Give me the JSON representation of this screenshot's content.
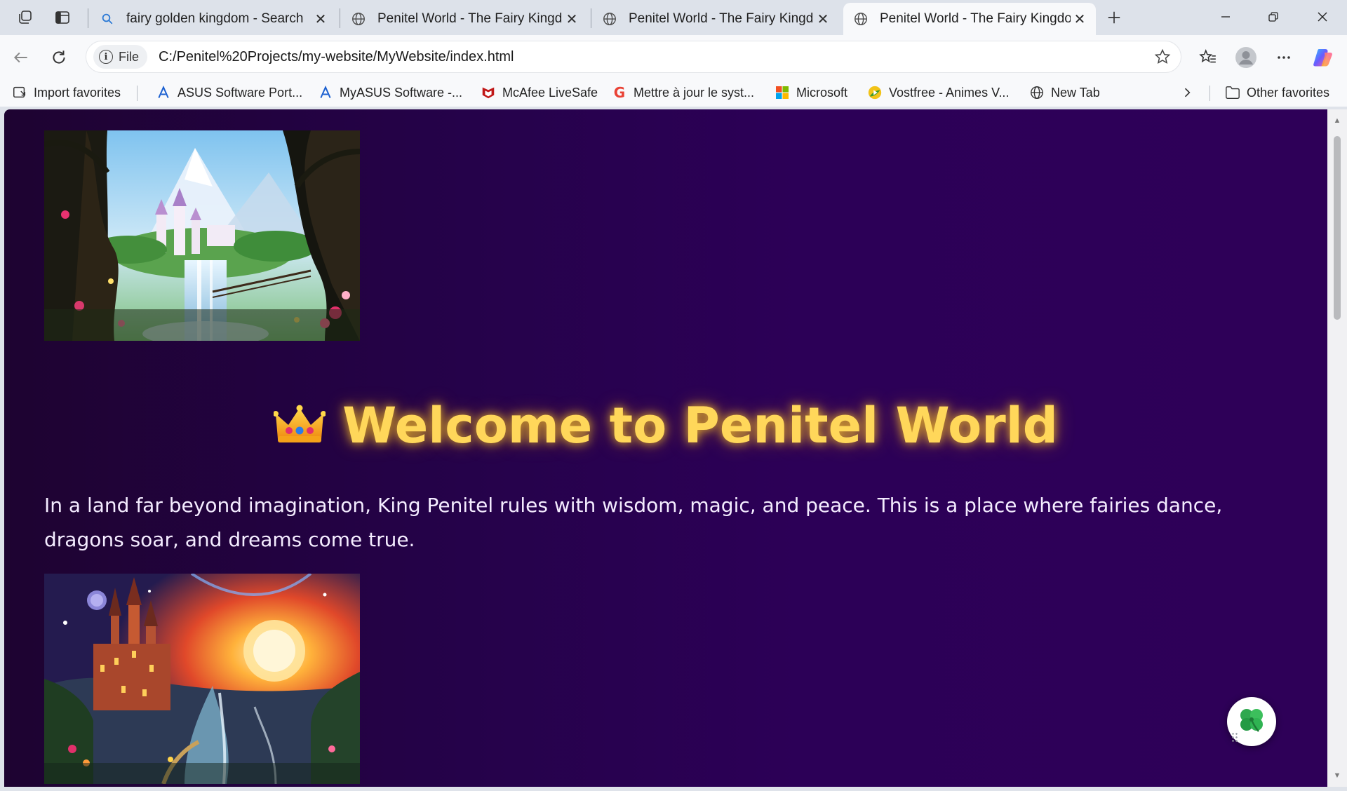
{
  "browser": {
    "tabs": [
      {
        "title": "fairy golden kingdom - Search",
        "icon": "search-icon",
        "active": false
      },
      {
        "title": "Penitel World - The Fairy Kingdom",
        "icon": "globe-icon",
        "active": false
      },
      {
        "title": "Penitel World - The Fairy Kingdom",
        "icon": "globe-icon",
        "active": false
      },
      {
        "title": "Penitel World - The Fairy Kingdom",
        "icon": "globe-icon",
        "active": true
      }
    ],
    "site_info_label": "File",
    "url": "C:/Penitel%20Projects/my-website/MyWebsite/index.html",
    "favorites": [
      {
        "label": "Import favorites",
        "icon": "import-icon"
      },
      {
        "label": "ASUS Software Port...",
        "icon": "asus-icon"
      },
      {
        "label": "MyASUS Software -...",
        "icon": "asus-icon"
      },
      {
        "label": "McAfee LiveSafe",
        "icon": "mcafee-icon"
      },
      {
        "label": "Mettre à jour le syst...",
        "icon": "google-icon"
      },
      {
        "label": "Microsoft",
        "icon": "microsoft-icon"
      },
      {
        "label": "Vostfree - Animes V...",
        "icon": "vostfree-icon"
      },
      {
        "label": "New Tab",
        "icon": "globe-icon"
      },
      {
        "label": "Other favorites",
        "icon": "folder-icon"
      }
    ]
  },
  "page": {
    "headline": "Welcome to Penitel World",
    "intro": "In a land far beyond imagination, King Penitel rules with wisdom, magic, and peace. This is a place where fairies dance, dragons soar, and dreams come true.",
    "colors": {
      "background": "#2c0057",
      "headline": "#ffd75a",
      "text": "#f4ecff"
    }
  }
}
